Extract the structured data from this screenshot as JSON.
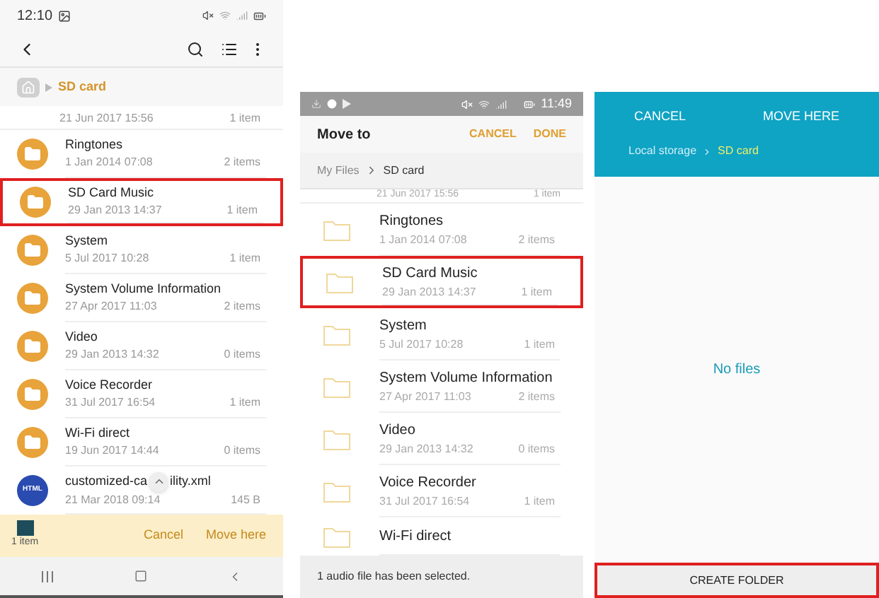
{
  "file_manager": {
    "status_bar": {
      "time": "12:10"
    },
    "breadcrumb": {
      "current": "SD card"
    },
    "partial_row": {
      "date": "21 Jun 2017 15:56",
      "count": "1 item"
    },
    "rows": [
      {
        "kind": "folder",
        "name": "Ringtones",
        "date": "1 Jan 2014 07:08",
        "count": "2 items",
        "highlighted": false
      },
      {
        "kind": "folder",
        "name": "SD Card Music",
        "date": "29 Jan 2013 14:37",
        "count": "1 item",
        "highlighted": true
      },
      {
        "kind": "folder",
        "name": "System",
        "date": "5 Jul 2017 10:28",
        "count": "1 item",
        "highlighted": false
      },
      {
        "kind": "folder",
        "name": "System Volume Information",
        "date": "27 Apr 2017 11:03",
        "count": "2 items",
        "highlighted": false
      },
      {
        "kind": "folder",
        "name": "Video",
        "date": "29 Jan 2013 14:32",
        "count": "0 items",
        "highlighted": false
      },
      {
        "kind": "folder",
        "name": "Voice Recorder",
        "date": "31 Jul 2017 16:54",
        "count": "1 item",
        "highlighted": false
      },
      {
        "kind": "folder",
        "name": "Wi-Fi direct",
        "date": "19 Jun 2017 14:44",
        "count": "0 items",
        "highlighted": false
      },
      {
        "kind": "html",
        "icon_label": "HTML",
        "name": "customized-ca",
        "name_end": "ility.xml",
        "date": "21 Mar 2018 09:14",
        "count": "145 B",
        "highlighted": false
      }
    ],
    "bottom_bar": {
      "selection": "1 item",
      "buttons": [
        "Cancel",
        "Move here"
      ]
    }
  },
  "move_dialog": {
    "status_bar": {
      "time": "11:49"
    },
    "title": "Move to",
    "actions": [
      "CANCEL",
      "DONE"
    ],
    "breadcrumb": [
      "My Files",
      "SD card"
    ],
    "partial_row": {
      "date": "21 Jun 2017 15:56",
      "count": "1 item"
    },
    "rows": [
      {
        "name": "Ringtones",
        "date": "1 Jan 2014 07:08",
        "count": "2 items",
        "highlighted": false
      },
      {
        "name": "SD Card Music",
        "date": "29 Jan 2013 14:37",
        "count": "1 item",
        "highlighted": true
      },
      {
        "name": "System",
        "date": "5 Jul 2017 10:28",
        "count": "1 item",
        "highlighted": false
      },
      {
        "name": "System Volume Information",
        "date": "27 Apr 2017 11:03",
        "count": "2 items",
        "highlighted": false
      },
      {
        "name": "Video",
        "date": "29 Jan 2013 14:32",
        "count": "0 items",
        "highlighted": false
      },
      {
        "name": "Voice Recorder",
        "date": "31 Jul 2017 16:54",
        "count": "1 item",
        "highlighted": false
      },
      {
        "name": "Wi-Fi direct",
        "highlighted": false
      }
    ],
    "status_message": "1 audio file has been selected."
  },
  "folder_picker": {
    "actions": [
      "CANCEL",
      "MOVE HERE"
    ],
    "breadcrumb": [
      "Local storage",
      "SD card"
    ],
    "empty_message": "No files",
    "create_button": {
      "label": "CREATE FOLDER",
      "highlighted": true
    }
  }
}
